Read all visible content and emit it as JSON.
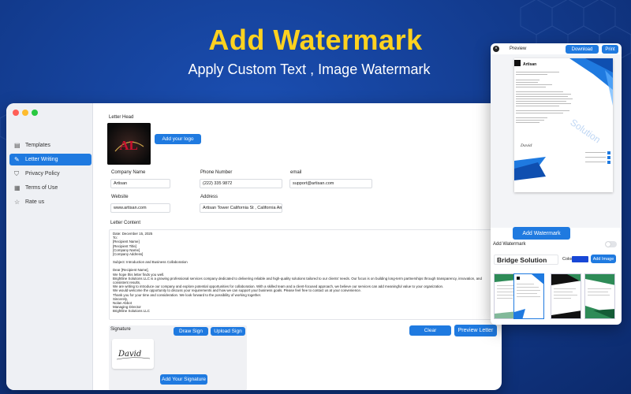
{
  "promo": {
    "headline": "Add Watermark",
    "subheadline": "Apply Custom Text , Image Watermark"
  },
  "colors": {
    "accent": "#1f7ae0",
    "headline": "#ffd21f",
    "watermark_color": "#1847d6"
  },
  "sidebar": {
    "items": [
      {
        "label": "Templates",
        "icon": "file-icon"
      },
      {
        "label": "Letter Writing",
        "icon": "pencil-icon",
        "active": true
      },
      {
        "label": "Privacy Policy",
        "icon": "shield-icon"
      },
      {
        "label": "Terms of Use",
        "icon": "document-icon"
      },
      {
        "label": "Rate us",
        "icon": "star-icon"
      }
    ]
  },
  "form": {
    "letter_head_label": "Letter Head",
    "add_logo_button": "Add your logo",
    "logo_text": "AL",
    "company_name": {
      "label": "Company Name",
      "value": "Artisan"
    },
    "phone_number": {
      "label": "Phone Number",
      "value": "(222) 335 9872"
    },
    "email": {
      "label": "email",
      "value": "support@artisan.com"
    },
    "website": {
      "label": "Website",
      "value": "www.artisan.com"
    },
    "address": {
      "label": "Address",
      "value": "Artisan Tower California St , California Ame"
    },
    "letter_content_label": "Letter Content",
    "letter_content": [
      "Date: December 15, 2025",
      "To:",
      "[Recipient Name]",
      "[Recipient Title]",
      "[Company Name]",
      "[Company Address]",
      "",
      "Subject: Introduction and Business Collaboration",
      "",
      "Dear [Recipient Name],",
      "We hope this letter finds you well.",
      "Brightline Solutions LLC is a growing professional services company dedicated to delivering reliable and high-quality solutions tailored to our clients' needs. Our focus is on building long-term partnerships through transparency, innovation, and consistent results.",
      "We are writing to introduce our company and explore potential opportunities for collaboration. With a skilled team and a client-focused approach, we believe our services can add meaningful value to your organization.",
      "We would welcome the opportunity to discuss your requirements and how we can support your business goals. Please feel free to contact us at your convenience.",
      "Thank you for your time and consideration. We look forward to the possibility of working together.",
      "Sincerely,",
      "Nolan Abbot",
      "Managing Director",
      "Brightline Solutions LLC"
    ],
    "signature_label": "Signature",
    "draw_sign_button": "Draw Sign",
    "upload_sign_button": "Upload Sign",
    "signature_text": "David",
    "add_signature_button": "Add Your Signature",
    "clear_button": "Clear",
    "preview_button": "Preview Letter"
  },
  "preview": {
    "title": "Preview",
    "download_button": "Download",
    "print_button": "Print",
    "doc_brand": "Artisan",
    "doc_signature": "David",
    "watermark_text": "Solution",
    "add_watermark_button": "Add Watermark",
    "add_watermark_label": "Add Watermark",
    "watermark_toggle_on": false,
    "watermark_input_value": "Bridge Solution",
    "color_label": "Color",
    "add_image_button": "Add Image"
  }
}
